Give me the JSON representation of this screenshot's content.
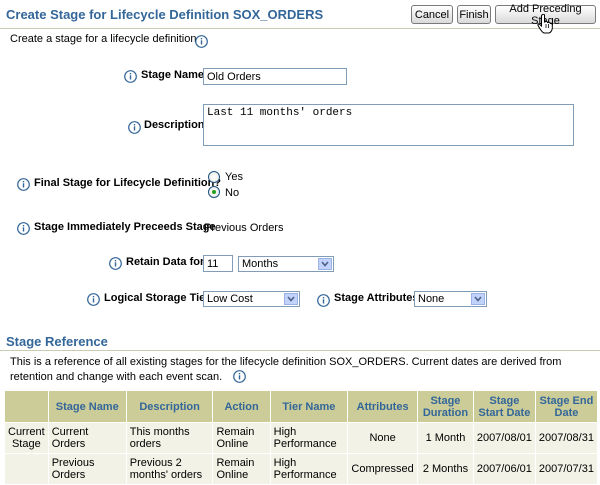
{
  "header": {
    "title": "Create Stage for Lifecycle Definition SOX_ORDERS",
    "buttons": {
      "cancel": "Cancel",
      "finish": "Finish",
      "add_preceding": "Add Preceding Stage"
    }
  },
  "form": {
    "description_text": "Create a stage for a lifecycle definition.",
    "stage_name": {
      "label": "Stage Name",
      "value": "Old Orders"
    },
    "description": {
      "label": "Description",
      "value": "Last 11 months' orders"
    },
    "final_stage": {
      "label": "Final Stage for Lifecycle Definition?",
      "options": [
        "Yes",
        "No"
      ],
      "selected": "No"
    },
    "preceeds": {
      "label": "Stage Immediately Preceeds Stage",
      "value": "Previous Orders"
    },
    "retain": {
      "label": "Retain Data for",
      "value": "11",
      "unit": "Months"
    },
    "storage_tier": {
      "label": "Logical Storage Tier",
      "value": "Low Cost"
    },
    "stage_attributes": {
      "label": "Stage Attributes",
      "value": "None"
    }
  },
  "reference": {
    "title": "Stage Reference",
    "text": "This is a reference of all existing stages for the lifecycle definition SOX_ORDERS. Current dates are derived from retention and change with each event scan.",
    "columns": [
      "",
      "Stage Name",
      "Description",
      "Action",
      "Tier Name",
      "Attributes",
      "Stage Duration",
      "Stage Start Date",
      "Stage End Date"
    ],
    "rows": [
      [
        "Current Stage",
        "Current Orders",
        "This months orders",
        "Remain Online",
        "High Performance",
        "None",
        "1 Month",
        "2007/08/01",
        "2007/08/31"
      ],
      [
        "",
        "Previous Orders",
        "Previous 2 months' orders",
        "Remain Online",
        "High Performance",
        "Compressed",
        "2 Months",
        "2007/06/01",
        "2007/07/31"
      ]
    ]
  }
}
